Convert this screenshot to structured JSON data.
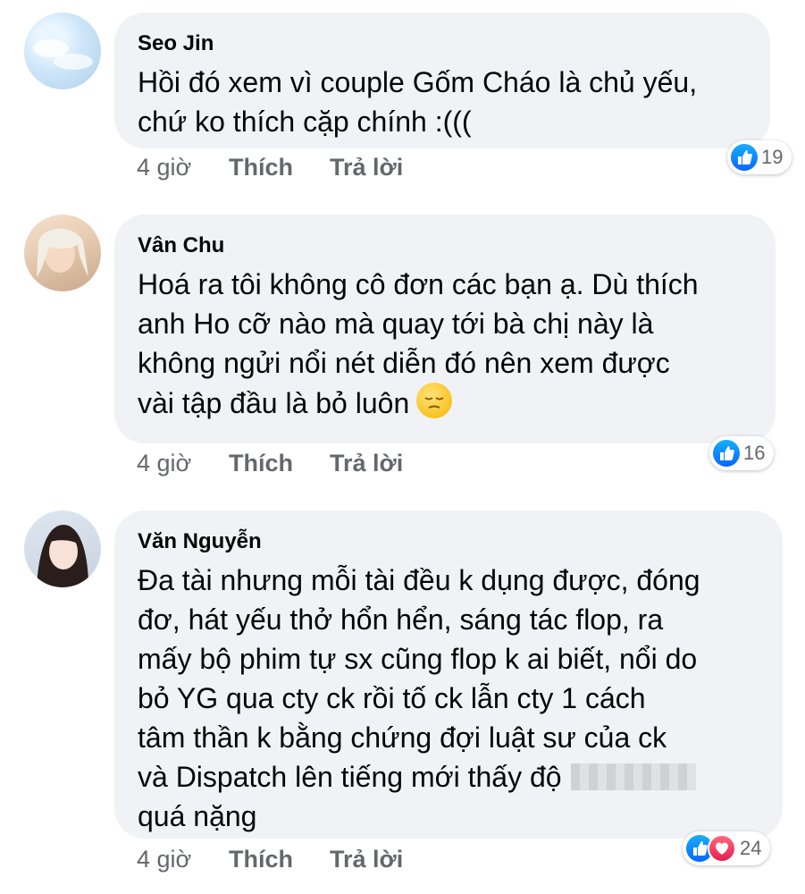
{
  "comments": [
    {
      "author": "Seo Jin",
      "lines": [
        "Hồi đó xem vì couple Gốm Cháo là chủ yếu,",
        "chứ ko thích cặp chính :((("
      ],
      "time": "4 giờ",
      "like_label": "Thích",
      "reply_label": "Trả lời",
      "reactions": [
        "like"
      ],
      "reaction_count": "19"
    },
    {
      "author": "Vân Chu",
      "lines": [
        "Hoá ra tôi không cô đơn các bạn ạ. Dù thích",
        "anh Ho cỡ nào mà quay tới bà chị này là",
        "không ngửi nổi nét diễn đó nên xem được",
        "vài tập đầu là bỏ luôn"
      ],
      "emoji": "pensive-face",
      "time": "4 giờ",
      "like_label": "Thích",
      "reply_label": "Trả lời",
      "reactions": [
        "like"
      ],
      "reaction_count": "16"
    },
    {
      "author": "Văn Nguyễn",
      "lines": [
        "Đa tài nhưng mỗi tài đều k dụng được, đóng",
        "đơ, hát yếu thở hổn hển, sáng tác flop, ra",
        "mấy bộ phim tự sx cũng flop k ai biết, nổi do",
        "bỏ YG qua cty ck rồi tố ck lẫn cty 1 cách",
        "tâm thần k bằng chứng đợi luật sư của ck",
        "và Dispatch lên tiếng mới thấy độ",
        "quá nặng"
      ],
      "redacted": true,
      "time": "4 giờ",
      "like_label": "Thích",
      "reply_label": "Trả lời",
      "reactions": [
        "like",
        "love"
      ],
      "reaction_count": "24"
    }
  ],
  "colors": {
    "bubble": "#f0f2f5",
    "text": "#050505",
    "meta": "#65676b",
    "like": "#0866ff",
    "love": "#e61e4d"
  }
}
